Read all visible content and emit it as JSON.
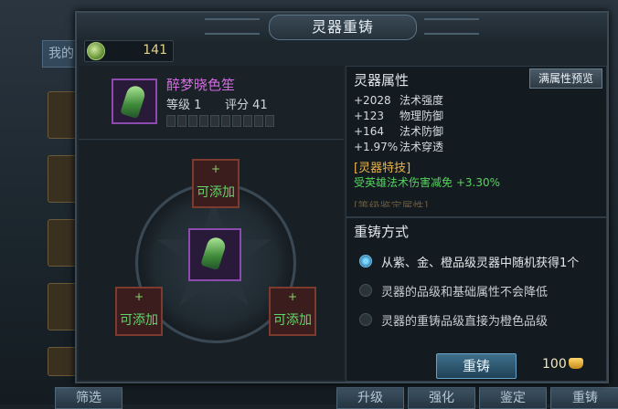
{
  "background": {
    "tab_label": "我的",
    "bottom_buttons": [
      "筛选",
      "升级",
      "强化",
      "鉴定",
      "重铸"
    ]
  },
  "dialog": {
    "title": "灵器重铸",
    "currency": {
      "icon": "jade-coin-icon",
      "value": "141"
    },
    "item": {
      "name": "醉梦晓色笙",
      "level_label": "等级 1",
      "score_label": "评分 41",
      "stars_total": 10,
      "stars_filled": 0
    },
    "slots": {
      "add_label": "可添加",
      "plus": "+"
    },
    "attributes": {
      "title": "灵器属性",
      "preview_button": "满属性预览",
      "rows": [
        {
          "value": "+2028",
          "name": "法术强度"
        },
        {
          "value": "+123",
          "name": "物理防御"
        },
        {
          "value": "+164",
          "name": "法术防御"
        },
        {
          "value": "+1.97%",
          "name": "法术穿透"
        }
      ],
      "skill_title": "[灵器特技]",
      "skill_text": "受英雄法术伤害减免 +3.30%",
      "cut_text": "[等级鉴定属性]"
    },
    "recast": {
      "title": "重铸方式",
      "options": [
        {
          "label": "从紫、金、橙品级灵器中随机获得1个",
          "selected": true
        },
        {
          "label": "灵器的品级和基础属性不会降低",
          "selected": false
        },
        {
          "label": "灵器的重铸品级直接为橙色品级",
          "selected": false
        }
      ],
      "button": "重铸",
      "cost": "100",
      "cost_icon": "gold-ingot-icon"
    }
  }
}
